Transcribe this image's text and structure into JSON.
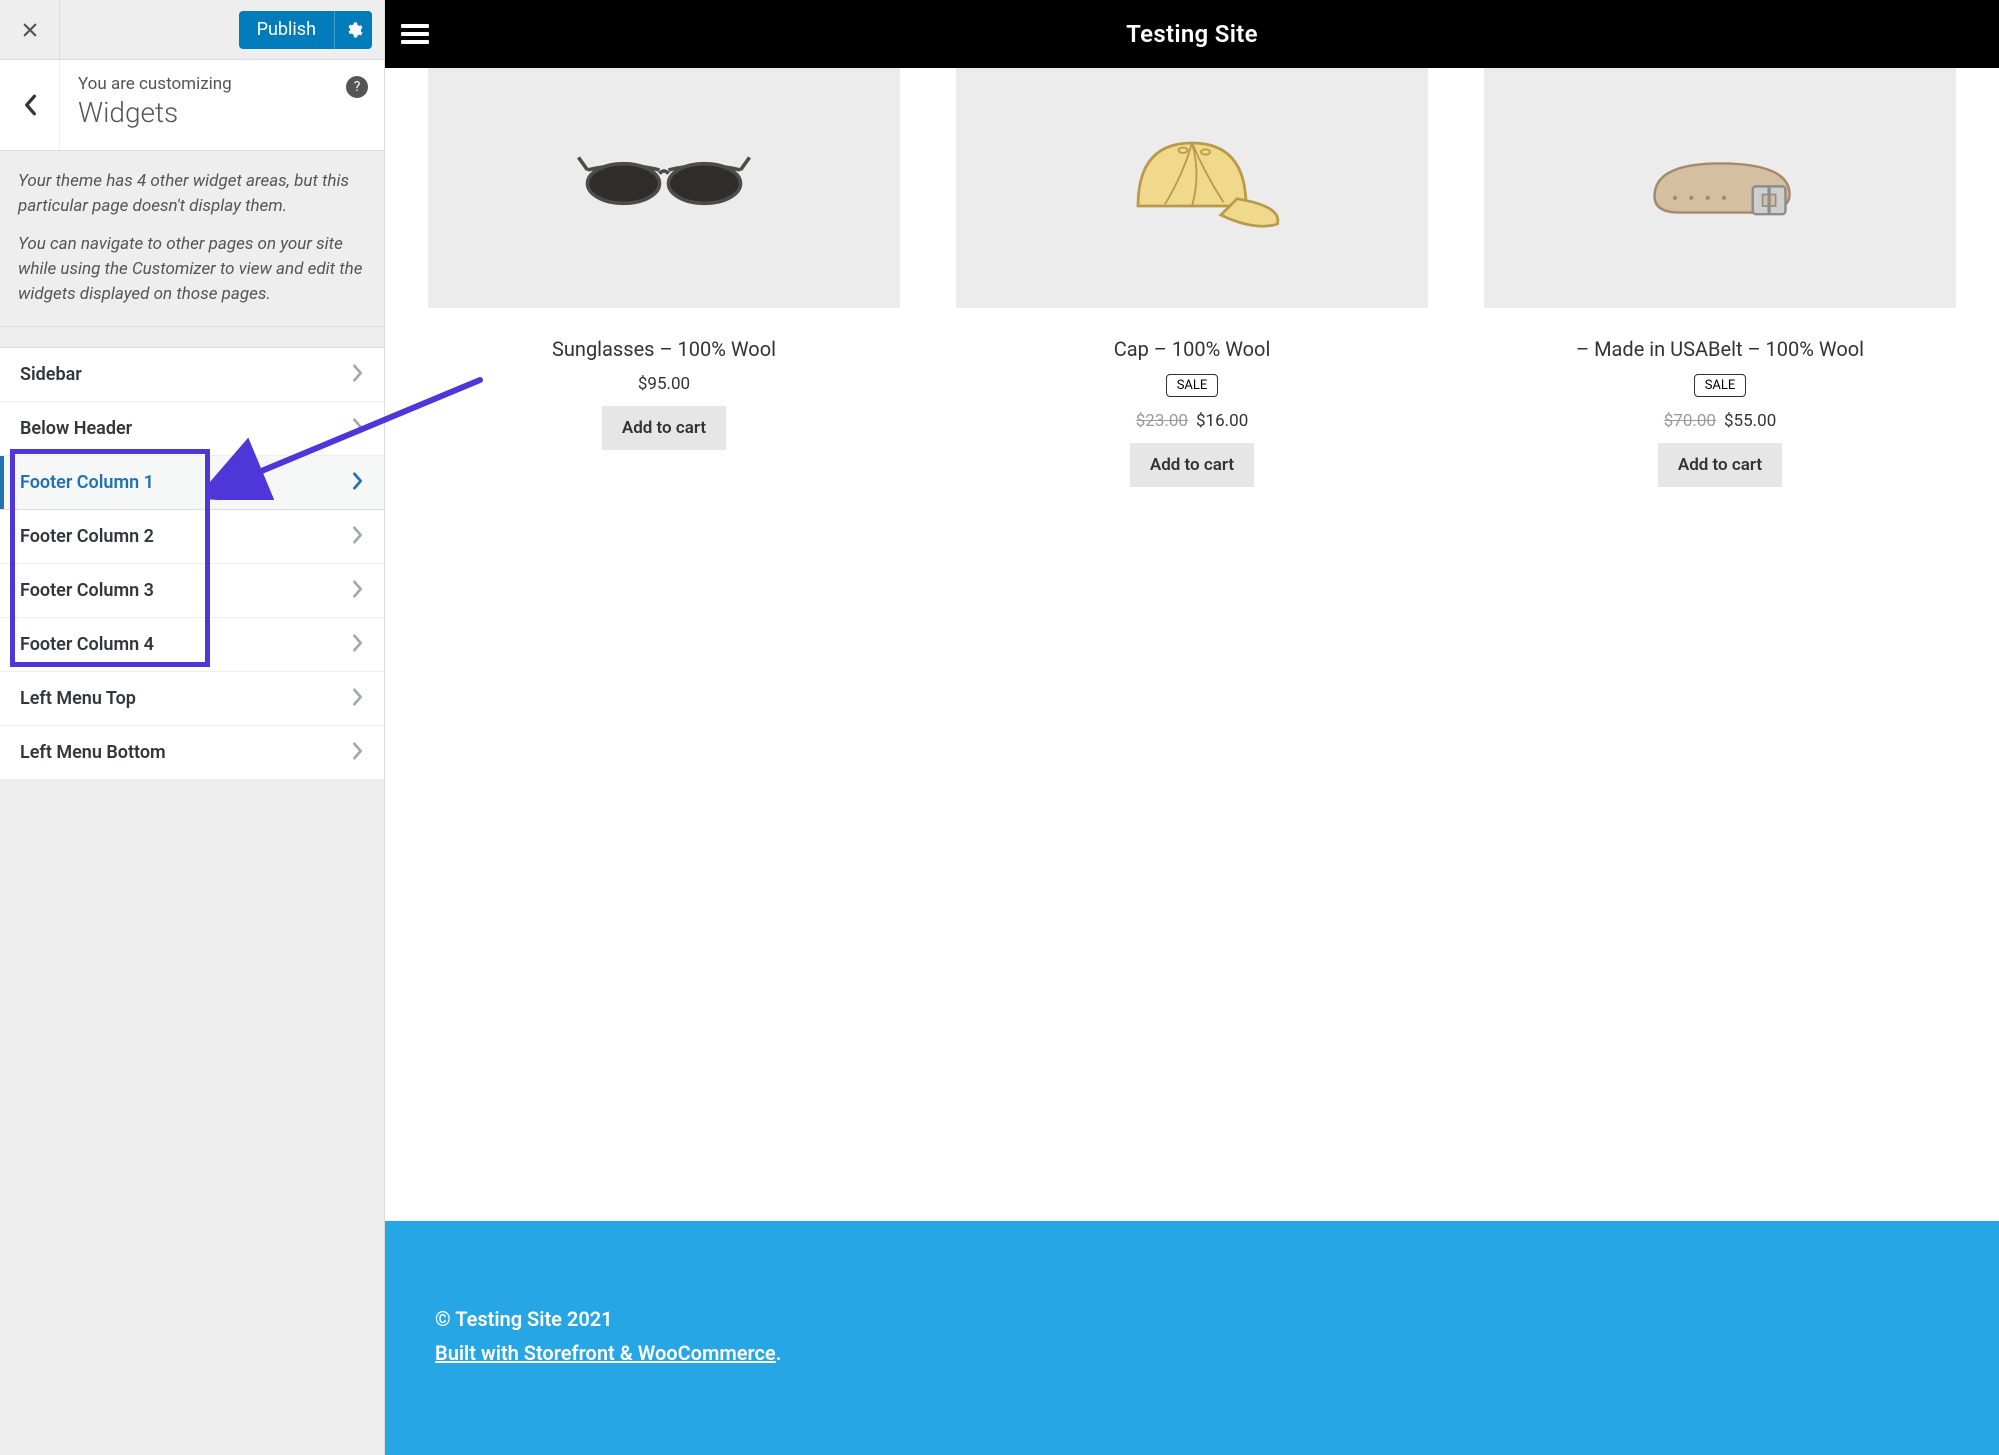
{
  "customizer": {
    "publish_label": "Publish",
    "eyebrow": "You are customizing",
    "title": "Widgets",
    "help_glyph": "?",
    "info_p1": "Your theme has 4 other widget areas, but this particular page doesn't display them.",
    "info_p2": "You can navigate to other pages on your site while using the Customizer to view and edit the widgets displayed on those pages.",
    "items": [
      {
        "label": "Sidebar",
        "active": false
      },
      {
        "label": "Below Header",
        "active": false
      },
      {
        "label": "Footer Column 1",
        "active": true
      },
      {
        "label": "Footer Column 2",
        "active": false
      },
      {
        "label": "Footer Column 3",
        "active": false
      },
      {
        "label": "Footer Column 4",
        "active": false
      },
      {
        "label": "Left Menu Top",
        "active": false
      },
      {
        "label": "Left Menu Bottom",
        "active": false
      }
    ]
  },
  "preview": {
    "site_title": "Testing Site",
    "products": [
      {
        "name": "Sunglasses – 100% Wool",
        "price": "$95.00",
        "old_price": "",
        "sale": false,
        "button": "Add to cart",
        "icon": "sunglasses"
      },
      {
        "name": "Cap – 100% Wool",
        "price": "$16.00",
        "old_price": "$23.00",
        "sale": true,
        "sale_label": "SALE",
        "button": "Add to cart",
        "icon": "cap"
      },
      {
        "name": "– Made in USABelt – 100% Wool",
        "price": "$55.00",
        "old_price": "$70.00",
        "sale": true,
        "sale_label": "SALE",
        "button": "Add to cart",
        "icon": "belt"
      }
    ],
    "footer": {
      "copyright": "© Testing Site 2021",
      "built_text": "Built with Storefront & WooCommerce",
      "built_suffix": "."
    }
  }
}
